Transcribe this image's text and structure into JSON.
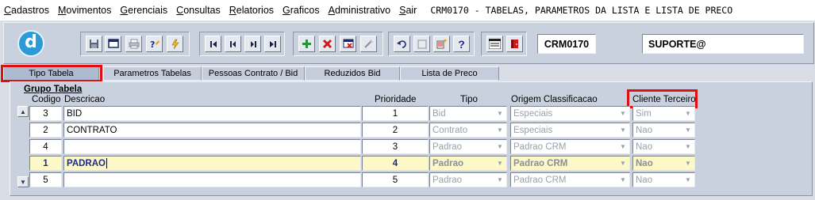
{
  "menu": {
    "items": [
      {
        "u": "C",
        "rest": "adastros"
      },
      {
        "u": "M",
        "rest": "ovimentos"
      },
      {
        "u": "G",
        "rest": "erenciais"
      },
      {
        "u": "C",
        "rest": "onsultas"
      },
      {
        "u": "R",
        "rest": "elatorios"
      },
      {
        "u": "G",
        "rest": "raficos"
      },
      {
        "u": "A",
        "rest": "dministrativo"
      },
      {
        "u": "S",
        "rest": "air"
      }
    ],
    "window_title": "CRM0170 - TABELAS, PARAMETROS DA LISTA E LISTA DE PRECO"
  },
  "toolbar": {
    "logo_letter": "d",
    "form_code": "CRM0170",
    "user": "SUPORTE@",
    "icons": [
      "save-icon",
      "window-icon",
      "print-icon",
      "query-icon",
      "execute-query-icon",
      "first-record-icon",
      "previous-record-icon",
      "next-record-icon",
      "last-record-icon",
      "insert-record-icon",
      "delete-record-icon",
      "clear-record-icon",
      "duplicate-icon",
      "undo-icon",
      "clipboard-icon",
      "list-values-icon",
      "help-icon",
      "menu-icon",
      "exit-icon"
    ]
  },
  "tabs": [
    {
      "label": "Tipo Tabela",
      "active": true
    },
    {
      "label": "Parametros Tabelas"
    },
    {
      "label": "Pessoas Contrato / Bid"
    },
    {
      "label": "Reduzidos Bid"
    },
    {
      "label": "Lista de Preco"
    }
  ],
  "grid": {
    "group_title": "Grupo Tabela",
    "headers": {
      "codigo": "Codigo",
      "descricao": "Descricao",
      "prioridade": "Prioridade",
      "tipo": "Tipo",
      "origem": "Origem Classificacao",
      "cliente": "Cliente Terceiro"
    },
    "rows": [
      {
        "codigo": "3",
        "descricao": "BID",
        "prioridade": "1",
        "tipo": "Bid",
        "origem": "Especiais",
        "cliente": "Sim"
      },
      {
        "codigo": "2",
        "descricao": "CONTRATO",
        "prioridade": "2",
        "tipo": "Contrato",
        "origem": "Especiais",
        "cliente": "Nao"
      },
      {
        "codigo": "4",
        "descricao": "",
        "prioridade": "3",
        "tipo": "Padrao",
        "origem": "Padrao CRM",
        "cliente": "Nao"
      },
      {
        "codigo": "1",
        "descricao": "PADRAO",
        "prioridade": "4",
        "tipo": "Padrao",
        "origem": "Padrao CRM",
        "cliente": "Nao",
        "selected": true
      },
      {
        "codigo": "5",
        "descricao": "",
        "prioridade": "5",
        "tipo": "Padrao",
        "origem": "Padrao CRM",
        "cliente": "Nao"
      }
    ]
  },
  "colors": {
    "highlight_box": "#e01010",
    "selected_row": "#fdf8c8",
    "panel": "#c9d0de"
  }
}
